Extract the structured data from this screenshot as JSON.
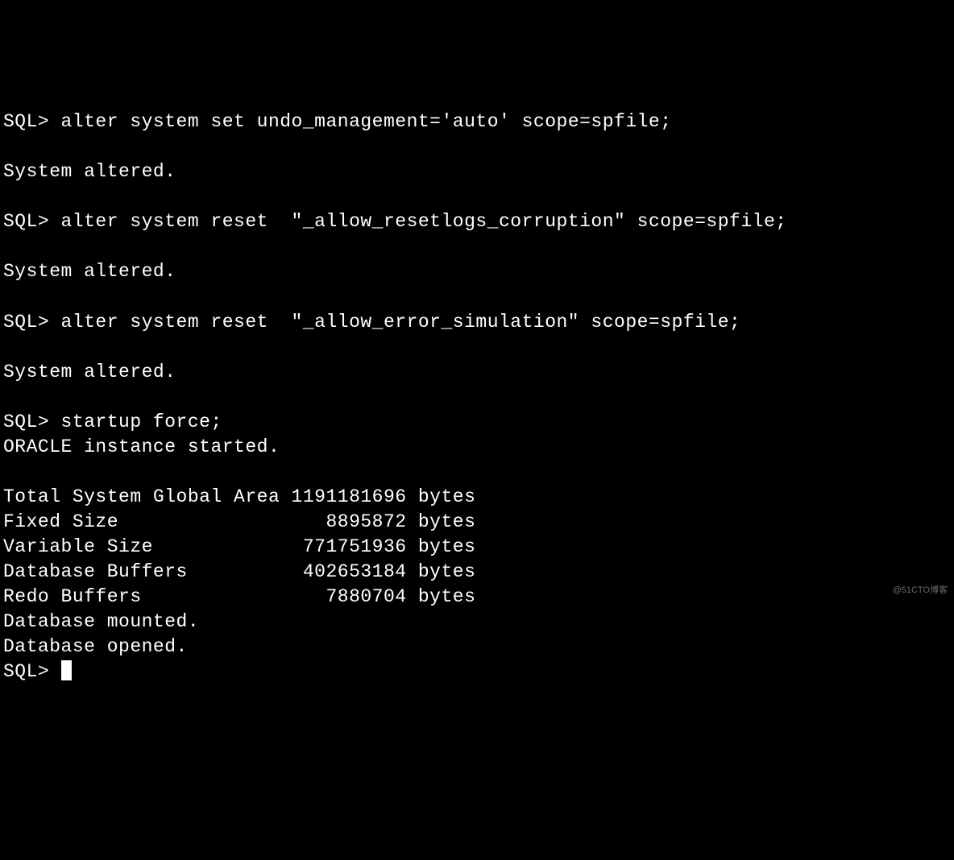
{
  "terminal": {
    "prompt": "SQL>",
    "lines": [
      "SQL> alter system set undo_management='auto' scope=spfile;",
      "",
      "System altered.",
      "",
      "SQL> alter system reset  \"_allow_resetlogs_corruption\" scope=spfile;",
      "",
      "System altered.",
      "",
      "SQL> alter system reset  \"_allow_error_simulation\" scope=spfile;",
      "",
      "System altered.",
      "",
      "SQL> startup force;",
      "ORACLE instance started.",
      "",
      "Total System Global Area 1191181696 bytes",
      "Fixed Size                  8895872 bytes",
      "Variable Size             771751936 bytes",
      "Database Buffers          402653184 bytes",
      "Redo Buffers                7880704 bytes",
      "Database mounted.",
      "Database opened.",
      "SQL> "
    ]
  },
  "commands": {
    "cmd1": "alter system set undo_management='auto' scope=spfile;",
    "cmd2": "alter system reset  \"_allow_resetlogs_corruption\" scope=spfile;",
    "cmd3": "alter system reset  \"_allow_error_simulation\" scope=spfile;",
    "cmd4": "startup force;",
    "response_altered": "System altered.",
    "response_started": "ORACLE instance started.",
    "response_mounted": "Database mounted.",
    "response_opened": "Database opened."
  },
  "memory": {
    "sga_label": "Total System Global Area",
    "sga_value": "1191181696",
    "fixed_label": "Fixed Size",
    "fixed_value": "8895872",
    "variable_label": "Variable Size",
    "variable_value": "771751936",
    "buffers_label": "Database Buffers",
    "buffers_value": "402653184",
    "redo_label": "Redo Buffers",
    "redo_value": "7880704",
    "unit": "bytes"
  },
  "watermark": "@51CTO博客"
}
